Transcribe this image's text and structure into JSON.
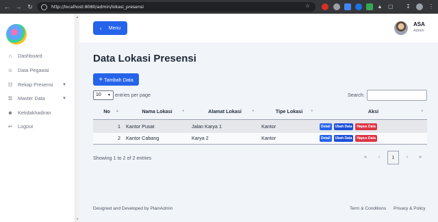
{
  "browser": {
    "url": "http://localhost:8080/admin/lokasi_presensi"
  },
  "sidebar": {
    "items": [
      {
        "label": "Dashboard",
        "icon": "home-icon"
      },
      {
        "label": "Data Pegawai",
        "icon": "users-icon"
      },
      {
        "label": "Rekap Presensi",
        "icon": "clipboard-icon",
        "has_caret": true
      },
      {
        "label": "Master Data",
        "icon": "database-icon",
        "has_caret": true
      },
      {
        "label": "Ketidakhadiran",
        "icon": "user-x-icon"
      },
      {
        "label": "Logout",
        "icon": "logout-icon"
      }
    ]
  },
  "header": {
    "menu_label": "Menu",
    "user_name": "ASA",
    "user_role": "Admin"
  },
  "page": {
    "title": "Data Lokasi Presensi",
    "add_button": "Tambah Data",
    "length_value": "10",
    "length_suffix": "entries per page",
    "search_label": "Search:"
  },
  "table": {
    "columns": [
      "No",
      "Nama Lokasi",
      "Alamat Lokasi",
      "Tipe Lokasi",
      "Aksi"
    ],
    "rows": [
      {
        "no": "1",
        "nama": "Kantor Pusat",
        "alamat": "Jalan Karya 1",
        "tipe": "Kantor"
      },
      {
        "no": "2",
        "nama": "Kantor Cabang",
        "alamat": "Karya 2",
        "tipe": "Kantor"
      }
    ],
    "actions": [
      "Detail",
      "Ubah Data",
      "Hapus Data"
    ]
  },
  "pagination": {
    "info": "Showing 1 to 2 of 2 entries",
    "first": "«",
    "prev": "‹",
    "current": "1",
    "next": "›",
    "last": "»"
  },
  "footer": {
    "credit": "Designed and Developed by PlainAdmin",
    "terms": "Term & Conditions",
    "privacy": "Privacy & Policy"
  },
  "colors": {
    "primary": "#2563eb",
    "danger": "#dc3545",
    "background": "#f1f5f9"
  }
}
